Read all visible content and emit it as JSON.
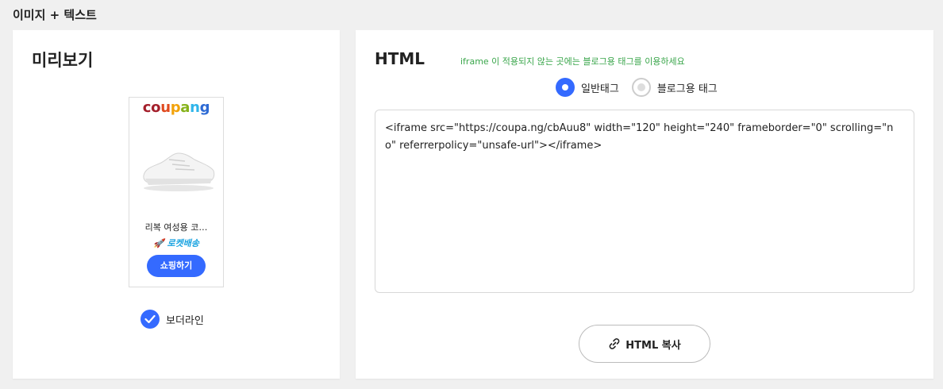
{
  "section_title": "이미지 + 텍스트",
  "preview": {
    "heading": "미리보기",
    "logo_letters": [
      {
        "ch": "c",
        "color": "#a41f2b"
      },
      {
        "ch": "o",
        "color": "#a41f2b"
      },
      {
        "ch": "u",
        "color": "#e04b20"
      },
      {
        "ch": "p",
        "color": "#f2a20a"
      },
      {
        "ch": "a",
        "color": "#86b21a"
      },
      {
        "ch": "n",
        "color": "#2fb5ea"
      },
      {
        "ch": "g",
        "color": "#2d6ad4"
      }
    ],
    "product_name": "리복 여성용 코…",
    "delivery_icon": "rocket-icon",
    "delivery_text": "🚀 로켓배송",
    "shop_button": "쇼핑하기",
    "border_option": {
      "label": "보더라인",
      "checked": true
    }
  },
  "html_panel": {
    "heading": "HTML",
    "hint": "iframe 이 적용되지 않는 곳에는 블로그용 태그를 이용하세요",
    "options": [
      {
        "label": "일반태그",
        "selected": true
      },
      {
        "label": "블로그용 태그",
        "selected": false
      }
    ],
    "code": "<iframe src=\"https://coupa.ng/cbAuu8\" width=\"120\" height=\"240\" frameborder=\"0\" scrolling=\"no\" referrerpolicy=\"unsafe-url\"></iframe>",
    "copy_button": "HTML 복사",
    "copy_icon": "link-icon"
  },
  "colors": {
    "accent": "#346aff",
    "hint_green": "#3aa64b",
    "rocket_blue": "#1aa3e0"
  }
}
